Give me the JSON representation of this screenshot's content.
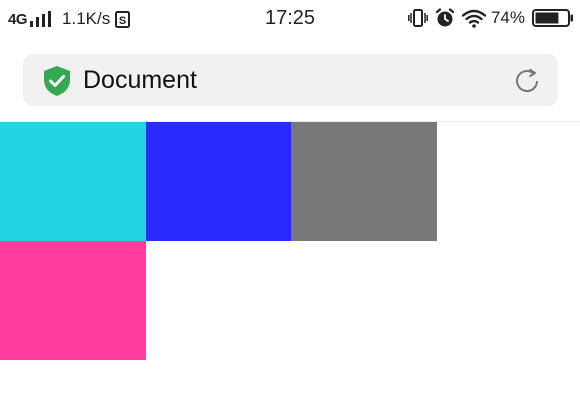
{
  "status_bar": {
    "network": "4G",
    "speed": "1.1K/s",
    "time": "17:25",
    "battery_percent": "74%",
    "battery_level": 0.74,
    "icons": [
      "signal-icon",
      "sim-icon",
      "vibrate-icon",
      "alarm-icon",
      "wifi-icon",
      "battery-icon"
    ]
  },
  "browser": {
    "page_title": "Document",
    "security_icon": "shield-check-icon",
    "security_color": "#34a853",
    "reload_icon": "reload-icon"
  },
  "tiles": [
    {
      "color": "#22d3e6"
    },
    {
      "color": "#2b2bff"
    },
    {
      "color": "#787878"
    },
    {
      "color": "#ff3d9e"
    }
  ]
}
